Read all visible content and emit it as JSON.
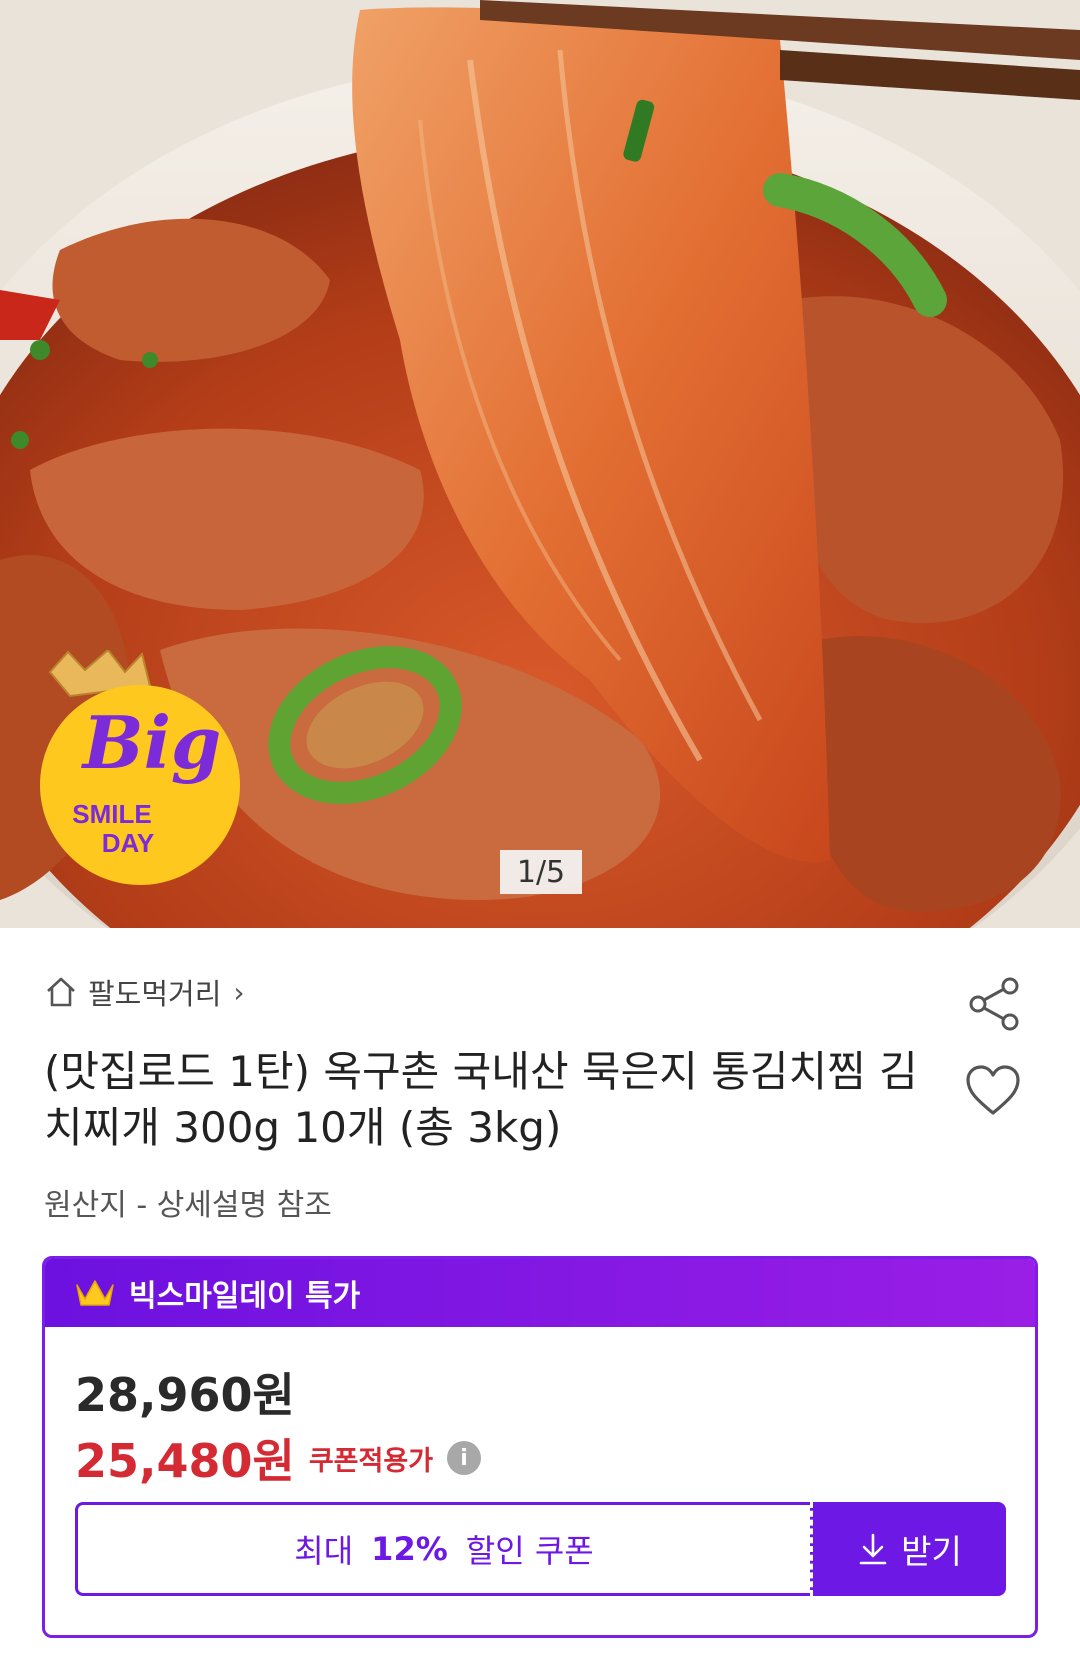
{
  "hero": {
    "page_indicator": "1/5",
    "badge": {
      "line1": "Big",
      "line2": "SMILE",
      "line3": "DAY"
    }
  },
  "seller": {
    "name": "팔도먹거리",
    "chevron": "›"
  },
  "product": {
    "title": "(맛집로드 1탄) 옥구촌 국내산 묵은지 통김치찜 김치찌개 300g 10개 (총 3kg)",
    "origin": "원산지 - 상세설명 참조"
  },
  "promo": {
    "header": "빅스마일데이 특가",
    "original_price": "28,960원",
    "sale_price": "25,480원",
    "coupon_applied_label": "쿠폰적용가",
    "info_glyph": "i",
    "coupon": {
      "prefix": "최대",
      "percent": "12%",
      "suffix": "할인 쿠폰",
      "button_label": "받기"
    }
  },
  "colors": {
    "brand_purple": "#6d18e4",
    "sale_red": "#d42a33",
    "badge_yellow": "#ffc81f"
  },
  "icons": [
    "home-icon",
    "share-icon",
    "heart-icon",
    "crown-icon",
    "info-icon",
    "download-icon"
  ]
}
